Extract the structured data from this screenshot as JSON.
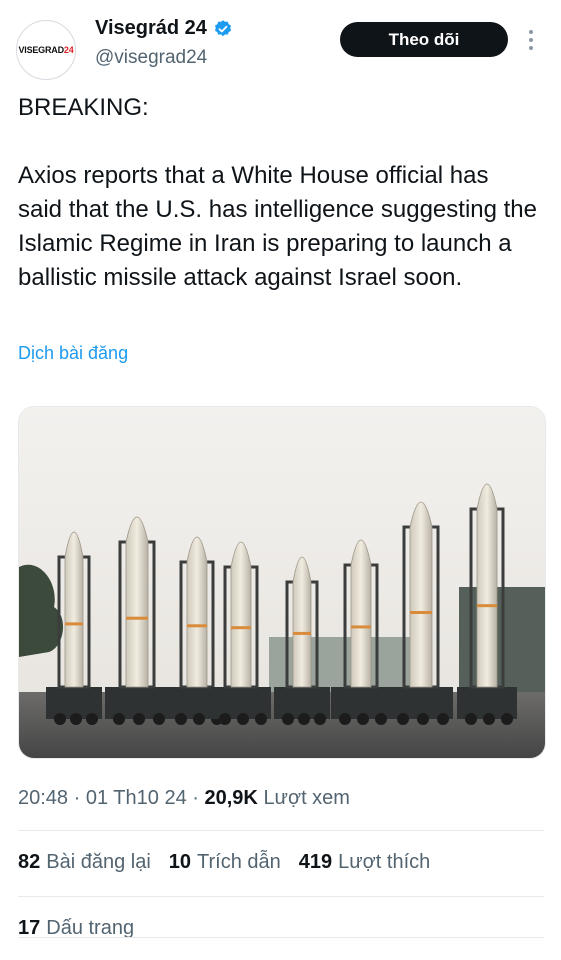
{
  "profile": {
    "avatar_text_prefix": "VISEGRAD",
    "avatar_text_suffix": "24",
    "display_name": "Visegrád 24",
    "handle": "@visegrad24",
    "verified": true,
    "follow_label": "Theo dõi"
  },
  "post": {
    "headline": "BREAKING:",
    "body": "Axios reports that a White House official has said that the U.S. has intelligence suggesting the Islamic Regime in Iran is preparing to launch a ballistic missile attack against Israel soon.",
    "translate_label": "Dịch bài đăng"
  },
  "media": {
    "image_description_icon": "missile-launchers-photo"
  },
  "meta": {
    "time": "20:48",
    "separator": "·",
    "date": "01 Th10 24",
    "views_count": "20,9K",
    "views_label": "Lượt xem"
  },
  "stats": {
    "reposts_count": "82",
    "reposts_label": "Bài đăng lại",
    "quotes_count": "10",
    "quotes_label": "Trích dẫn",
    "likes_count": "419",
    "likes_label": "Lượt thích",
    "bookmarks_count": "17",
    "bookmarks_label": "Dấu trang"
  },
  "colors": {
    "link": "#1d9bf0",
    "verified": "#1d9bf0",
    "follow_bg": "#0f1419",
    "muted": "#536471"
  }
}
